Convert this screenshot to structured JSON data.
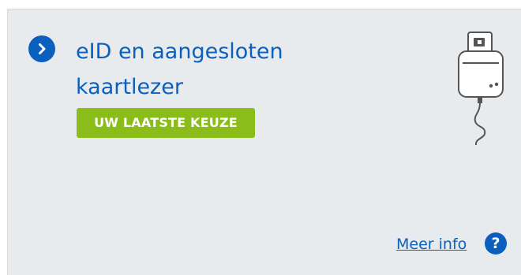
{
  "card": {
    "title": "eID en aangesloten kaartlezer",
    "badge": "UW LAATSTE KEUZE",
    "more_info": "Meer info",
    "help_glyph": "?",
    "icons": {
      "expand": "chevron-right-icon",
      "illustration": "card-reader-icon",
      "help": "question-icon"
    },
    "colors": {
      "accent": "#0b5fbd",
      "badge": "#8bbd1a",
      "background": "#e8ebee"
    }
  }
}
